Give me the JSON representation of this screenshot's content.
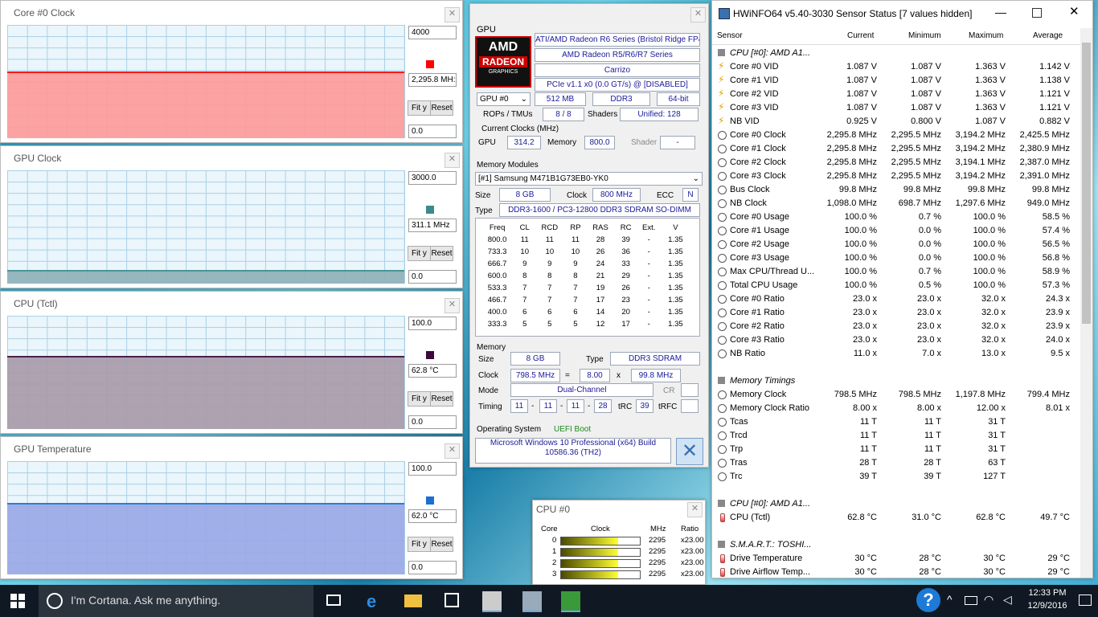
{
  "graphs": [
    {
      "title": "Core #0 Clock",
      "top_value": "4000",
      "current": "2,295.8 MH:",
      "bottom_value": "0.0",
      "fit": "Fit y",
      "reset": "Reset",
      "color": "#ff0000",
      "fill": "#ff9a9a",
      "level_fraction": 0.574
    },
    {
      "title": "GPU Clock",
      "top_value": "3000.0",
      "current": "311.1 MHz",
      "bottom_value": "0.0",
      "fit": "Fit y",
      "reset": "Reset",
      "color": "#3a8c8c",
      "fill": "#8fb1b8",
      "level_fraction": 0.104
    },
    {
      "title": "CPU (Tctl)",
      "top_value": "100.0",
      "current": "62.8 °C",
      "bottom_value": "0.0",
      "fit": "Fit y",
      "reset": "Reset",
      "color": "#3a0a3a",
      "fill": "#a89aa9",
      "level_fraction": 0.628
    },
    {
      "title": "GPU Temperature",
      "top_value": "100.0",
      "current": "62.0 °C",
      "bottom_value": "0.0",
      "fit": "Fit y",
      "reset": "Reset",
      "color": "#1a6fd0",
      "fill": "#9aa8e6",
      "level_fraction": 0.62
    }
  ],
  "gpu": {
    "section": "GPU",
    "logo_top": "AMD",
    "logo_mid": "RADEON",
    "logo_bot": "GRAPHICS",
    "name1": "ATI/AMD Radeon R6 Series (Bristol Ridge FP4)",
    "name2": "AMD Radeon R5/R6/R7 Series",
    "codename": "Carrizo",
    "bus": "PCIe v1.1 x0 (0.0 GT/s) @ [DISABLED]",
    "select": "GPU #0",
    "vram": "512 MB",
    "vram_type": "DDR3",
    "bus_width": "64-bit",
    "rops_label": "ROPs / TMUs",
    "rops": "8 / 8",
    "shaders_label": "Shaders",
    "shaders": "Unified: 128",
    "clocks_label": "Current Clocks (MHz)",
    "gpu_label": "GPU",
    "gpu_clock": "314.2",
    "memory_label": "Memory",
    "mem_clock": "800.0",
    "shader_label": "Shader",
    "shader_clock": "-",
    "mm_label": "Memory Modules",
    "module": "[#1] Samsung M471B1G73EB0-YK0",
    "size_label": "Size",
    "size": "8 GB",
    "clock_label": "Clock",
    "clock": "800 MHz",
    "ecc_label": "ECC",
    "ecc": "N",
    "type_label": "Type",
    "type": "DDR3-1600 / PC3-12800 DDR3 SDRAM SO-DIMM",
    "timing_headers": [
      "Freq",
      "CL",
      "RCD",
      "RP",
      "RAS",
      "RC",
      "Ext.",
      "V"
    ],
    "timing_rows": [
      [
        "800.0",
        "11",
        "11",
        "11",
        "28",
        "39",
        "-",
        "1.35"
      ],
      [
        "733.3",
        "10",
        "10",
        "10",
        "26",
        "36",
        "-",
        "1.35"
      ],
      [
        "666.7",
        "9",
        "9",
        "9",
        "24",
        "33",
        "-",
        "1.35"
      ],
      [
        "600.0",
        "8",
        "8",
        "8",
        "21",
        "29",
        "-",
        "1.35"
      ],
      [
        "533.3",
        "7",
        "7",
        "7",
        "19",
        "26",
        "-",
        "1.35"
      ],
      [
        "466.7",
        "7",
        "7",
        "7",
        "17",
        "23",
        "-",
        "1.35"
      ],
      [
        "400.0",
        "6",
        "6",
        "6",
        "14",
        "20",
        "-",
        "1.35"
      ],
      [
        "333.3",
        "5",
        "5",
        "5",
        "12",
        "17",
        "-",
        "1.35"
      ]
    ],
    "memory_section": "Memory",
    "msize": "8 GB",
    "mtype": "DDR3 SDRAM",
    "mclock": "798.5 MHz",
    "eq": "=",
    "mult": "8.00",
    "times": "x",
    "bclk": "99.8 MHz",
    "mode_label": "Mode",
    "mode": "Dual-Channel",
    "cr_label": "CR",
    "timing_label": "Timing",
    "t1": "11",
    "t2": "11",
    "t3": "11",
    "t4": "28",
    "dash": "-",
    "trc_label": "tRC",
    "trc": "39",
    "trfc_label": "tRFC",
    "os_label": "Operating System",
    "boot": "UEFI Boot",
    "os": "Microsoft Windows 10 Professional (x64) Build 10586.36 (TH2)"
  },
  "cpu0": {
    "title": "CPU #0",
    "h_core": "Core",
    "h_clock": "Clock",
    "h_mhz": "MHz",
    "h_ratio": "Ratio",
    "rows": [
      {
        "core": "0",
        "mhz": "2295",
        "ratio": "x23.00"
      },
      {
        "core": "1",
        "mhz": "2295",
        "ratio": "x23.00"
      },
      {
        "core": "2",
        "mhz": "2295",
        "ratio": "x23.00"
      },
      {
        "core": "3",
        "mhz": "2295",
        "ratio": "x23.00"
      }
    ]
  },
  "hwinfo": {
    "title": "HWiNFO64 v5.40-3030 Sensor Status [7 values hidden]",
    "headers": [
      "Sensor",
      "Current",
      "Minimum",
      "Maximum",
      "Average"
    ],
    "rows": [
      {
        "kind": "group",
        "name": "CPU [#0]: AMD A1..."
      },
      {
        "kind": "volt",
        "name": "Core #0 VID",
        "v": [
          "1.087 V",
          "1.087 V",
          "1.363 V",
          "1.142 V"
        ]
      },
      {
        "kind": "volt",
        "name": "Core #1 VID",
        "v": [
          "1.087 V",
          "1.087 V",
          "1.363 V",
          "1.138 V"
        ]
      },
      {
        "kind": "volt",
        "name": "Core #2 VID",
        "v": [
          "1.087 V",
          "1.087 V",
          "1.363 V",
          "1.121 V"
        ]
      },
      {
        "kind": "volt",
        "name": "Core #3 VID",
        "v": [
          "1.087 V",
          "1.087 V",
          "1.363 V",
          "1.121 V"
        ]
      },
      {
        "kind": "volt",
        "name": "NB VID",
        "v": [
          "0.925 V",
          "0.800 V",
          "1.087 V",
          "0.882 V"
        ]
      },
      {
        "kind": "clock",
        "name": "Core #0 Clock",
        "v": [
          "2,295.8 MHz",
          "2,295.5 MHz",
          "3,194.2 MHz",
          "2,425.5 MHz"
        ]
      },
      {
        "kind": "clock",
        "name": "Core #1 Clock",
        "v": [
          "2,295.8 MHz",
          "2,295.5 MHz",
          "3,194.2 MHz",
          "2,380.9 MHz"
        ]
      },
      {
        "kind": "clock",
        "name": "Core #2 Clock",
        "v": [
          "2,295.8 MHz",
          "2,295.5 MHz",
          "3,194.1 MHz",
          "2,387.0 MHz"
        ]
      },
      {
        "kind": "clock",
        "name": "Core #3 Clock",
        "v": [
          "2,295.8 MHz",
          "2,295.5 MHz",
          "3,194.2 MHz",
          "2,391.0 MHz"
        ]
      },
      {
        "kind": "clock",
        "name": "Bus Clock",
        "v": [
          "99.8 MHz",
          "99.8 MHz",
          "99.8 MHz",
          "99.8 MHz"
        ]
      },
      {
        "kind": "clock",
        "name": "NB Clock",
        "v": [
          "1,098.0 MHz",
          "698.7 MHz",
          "1,297.6 MHz",
          "949.0 MHz"
        ]
      },
      {
        "kind": "clock",
        "name": "Core #0 Usage",
        "v": [
          "100.0 %",
          "0.7 %",
          "100.0 %",
          "58.5 %"
        ]
      },
      {
        "kind": "clock",
        "name": "Core #1 Usage",
        "v": [
          "100.0 %",
          "0.0 %",
          "100.0 %",
          "57.4 %"
        ]
      },
      {
        "kind": "clock",
        "name": "Core #2 Usage",
        "v": [
          "100.0 %",
          "0.0 %",
          "100.0 %",
          "56.5 %"
        ]
      },
      {
        "kind": "clock",
        "name": "Core #3 Usage",
        "v": [
          "100.0 %",
          "0.0 %",
          "100.0 %",
          "56.8 %"
        ]
      },
      {
        "kind": "clock",
        "name": "Max CPU/Thread U...",
        "v": [
          "100.0 %",
          "0.7 %",
          "100.0 %",
          "58.9 %"
        ]
      },
      {
        "kind": "clock",
        "name": "Total CPU Usage",
        "v": [
          "100.0 %",
          "0.5 %",
          "100.0 %",
          "57.3 %"
        ]
      },
      {
        "kind": "clock",
        "name": "Core #0 Ratio",
        "v": [
          "23.0 x",
          "23.0 x",
          "32.0 x",
          "24.3 x"
        ]
      },
      {
        "kind": "clock",
        "name": "Core #1 Ratio",
        "v": [
          "23.0 x",
          "23.0 x",
          "32.0 x",
          "23.9 x"
        ]
      },
      {
        "kind": "clock",
        "name": "Core #2 Ratio",
        "v": [
          "23.0 x",
          "23.0 x",
          "32.0 x",
          "23.9 x"
        ]
      },
      {
        "kind": "clock",
        "name": "Core #3 Ratio",
        "v": [
          "23.0 x",
          "23.0 x",
          "32.0 x",
          "24.0 x"
        ]
      },
      {
        "kind": "clock",
        "name": "NB Ratio",
        "v": [
          "11.0 x",
          "7.0 x",
          "13.0 x",
          "9.5 x"
        ]
      },
      {
        "kind": "blank",
        "name": ""
      },
      {
        "kind": "group",
        "name": "Memory Timings"
      },
      {
        "kind": "clock",
        "name": "Memory Clock",
        "v": [
          "798.5 MHz",
          "798.5 MHz",
          "1,197.8 MHz",
          "799.4 MHz"
        ]
      },
      {
        "kind": "clock",
        "name": "Memory Clock Ratio",
        "v": [
          "8.00 x",
          "8.00 x",
          "12.00 x",
          "8.01 x"
        ]
      },
      {
        "kind": "clock",
        "name": "Tcas",
        "v": [
          "11 T",
          "11 T",
          "31 T",
          ""
        ]
      },
      {
        "kind": "clock",
        "name": "Trcd",
        "v": [
          "11 T",
          "11 T",
          "31 T",
          ""
        ]
      },
      {
        "kind": "clock",
        "name": "Trp",
        "v": [
          "11 T",
          "11 T",
          "31 T",
          ""
        ]
      },
      {
        "kind": "clock",
        "name": "Tras",
        "v": [
          "28 T",
          "28 T",
          "63 T",
          ""
        ]
      },
      {
        "kind": "clock",
        "name": "Trc",
        "v": [
          "39 T",
          "39 T",
          "127 T",
          ""
        ]
      },
      {
        "kind": "blank",
        "name": ""
      },
      {
        "kind": "group",
        "name": "CPU [#0]: AMD A1..."
      },
      {
        "kind": "temp",
        "name": "CPU (Tctl)",
        "v": [
          "62.8 °C",
          "31.0 °C",
          "62.8 °C",
          "49.7 °C"
        ]
      },
      {
        "kind": "blank",
        "name": ""
      },
      {
        "kind": "group",
        "name": "S.M.A.R.T.: TOSHI..."
      },
      {
        "kind": "temp",
        "name": "Drive Temperature",
        "v": [
          "30 °C",
          "28 °C",
          "30 °C",
          "29 °C"
        ]
      },
      {
        "kind": "temp",
        "name": "Drive Airflow Temp...",
        "v": [
          "30 °C",
          "28 °C",
          "30 °C",
          "29 °C"
        ]
      }
    ]
  },
  "taskbar": {
    "cortana": "I'm Cortana. Ask me anything.",
    "time": "12:33 PM",
    "date": "12/9/2016"
  }
}
